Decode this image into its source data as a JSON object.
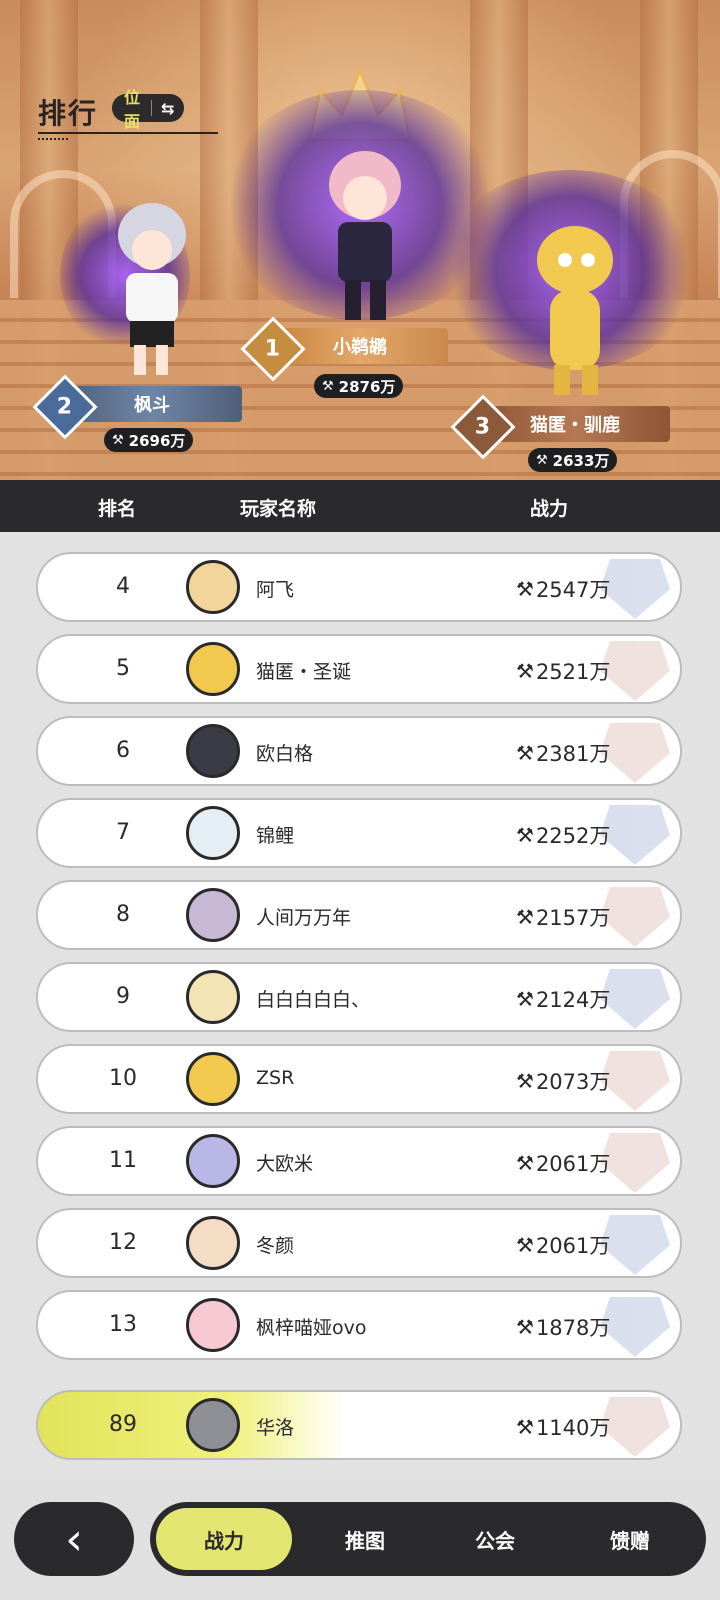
{
  "header": {
    "title": "排行",
    "switch_label": "位面",
    "switch_icon": "swap-icon"
  },
  "podium": [
    {
      "rank": "1",
      "name": "小鹈鹕",
      "power": "2876万"
    },
    {
      "rank": "2",
      "name": "枫斗",
      "power": "2696万"
    },
    {
      "rank": "3",
      "name": "猫匿・驯鹿",
      "power": "2633万"
    }
  ],
  "table_header": {
    "rank": "排名",
    "player": "玩家名称",
    "power": "战力"
  },
  "rows": [
    {
      "rank": "4",
      "name": "阿飞",
      "power": "2547万"
    },
    {
      "rank": "5",
      "name": "猫匿・圣诞",
      "power": "2521万"
    },
    {
      "rank": "6",
      "name": "欧白格",
      "power": "2381万"
    },
    {
      "rank": "7",
      "name": "锦鲤",
      "power": "2252万"
    },
    {
      "rank": "8",
      "name": "人间万万年",
      "power": "2157万"
    },
    {
      "rank": "9",
      "name": "白白白白白、",
      "power": "2124万"
    },
    {
      "rank": "10",
      "name": "ZSR",
      "power": "2073万"
    },
    {
      "rank": "11",
      "name": "大欧米",
      "power": "2061万"
    },
    {
      "rank": "12",
      "name": "冬颜",
      "power": "2061万"
    },
    {
      "rank": "13",
      "name": "枫梓喵娅ovo",
      "power": "1878万"
    }
  ],
  "self_row": {
    "rank": "89",
    "name": "华洛",
    "power": "1140万"
  },
  "nav": {
    "back_icon": "chevron-left-icon",
    "tabs": [
      "战力",
      "推图",
      "公会",
      "馈赠"
    ],
    "active_tab": "战力"
  },
  "colors": {
    "accent": "#e3e571",
    "dark": "#2a2a2c"
  }
}
